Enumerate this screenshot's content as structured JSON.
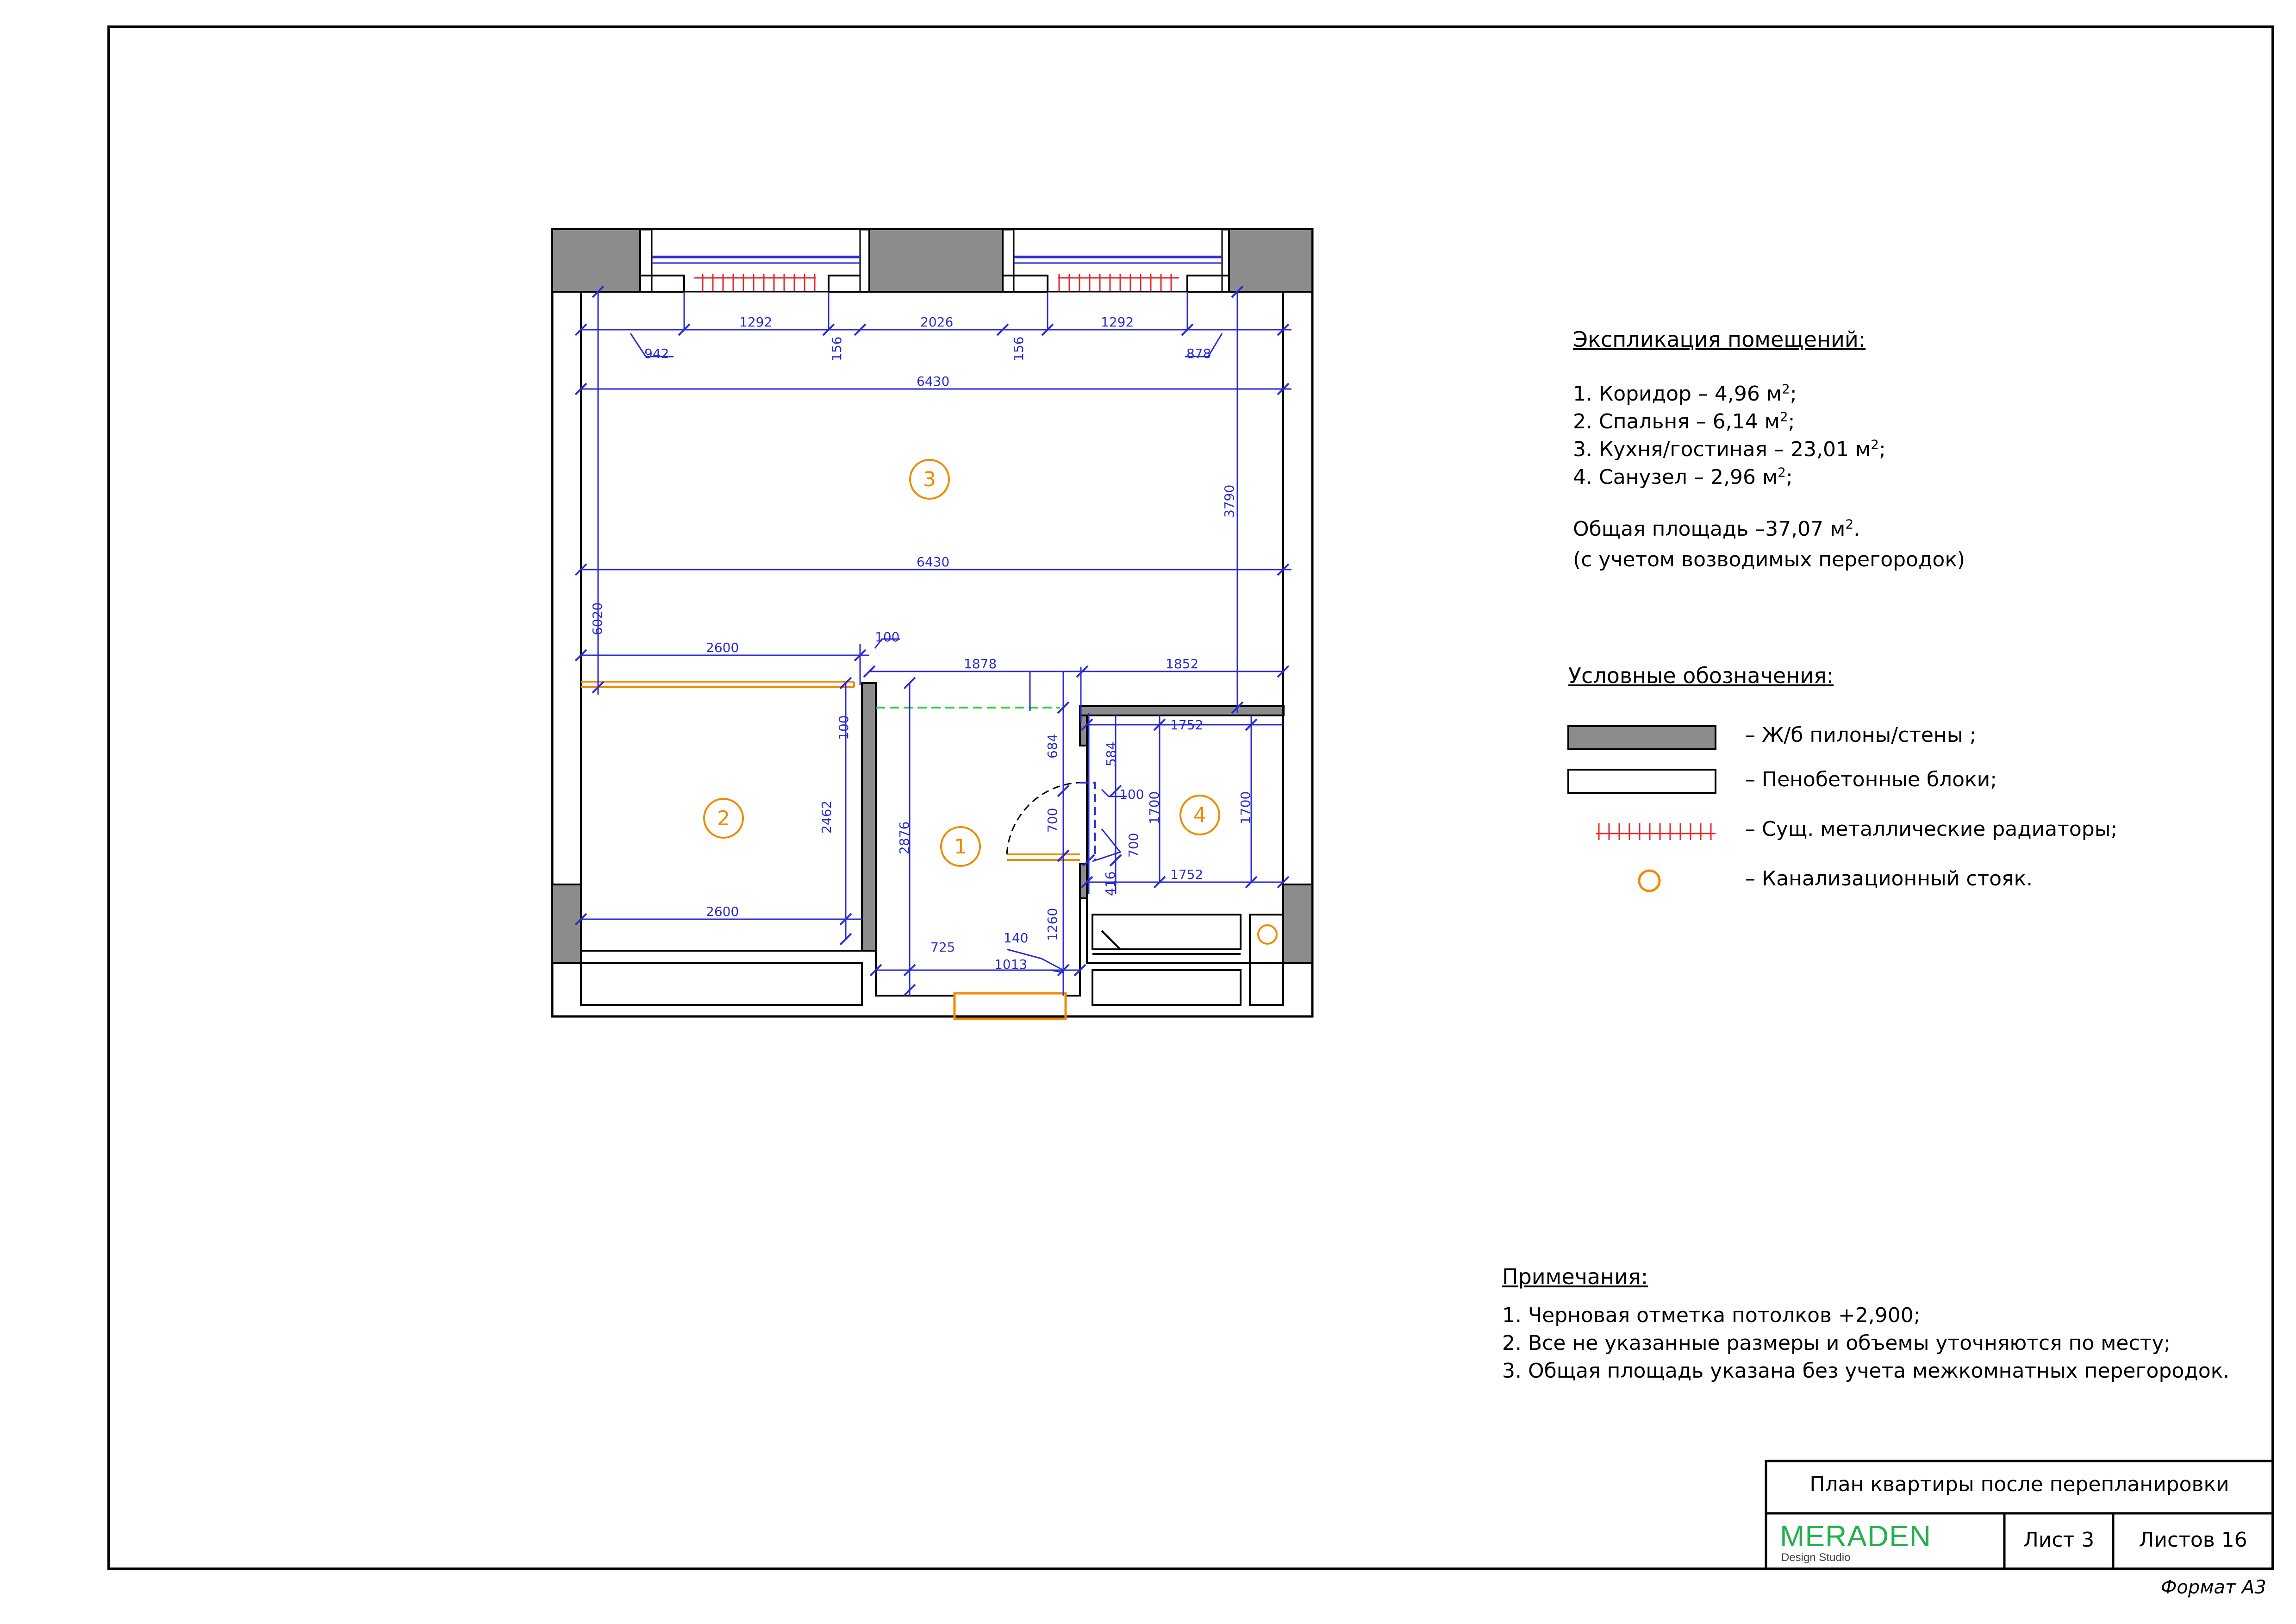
{
  "plan": {
    "dimensions": {
      "d942": "942",
      "d1292a": "1292",
      "d156a": "156",
      "d2026": "2026",
      "d156b": "156",
      "d1292b": "1292",
      "d878": "878",
      "d6430a": "6430",
      "d3790": "3790",
      "d6430b": "6430",
      "d6020": "6020",
      "d2600a": "2600",
      "d100a": "100",
      "d1878": "1878",
      "d1852": "1852",
      "d100b": "100",
      "d1752a": "1752",
      "d684": "684",
      "d584": "584",
      "d100c": "100",
      "d700a": "700",
      "d1700a": "1700",
      "d700b": "700",
      "d1700b": "1700",
      "d2462": "2462",
      "d2876": "2876",
      "d416": "416",
      "d1752b": "1752",
      "d2600b": "2600",
      "d1260": "1260",
      "d140": "140",
      "d725": "725",
      "d1013": "1013"
    },
    "rooms": {
      "r1": "1",
      "r2": "2",
      "r3": "3",
      "r4": "4"
    }
  },
  "explication": {
    "title": "Экспликация помещений:",
    "items": [
      {
        "text": "1. Коридор – 4,96 м",
        "sup": "2",
        "tail": ";"
      },
      {
        "text": "2. Спальня – 6,14 м",
        "sup": "2",
        "tail": ";"
      },
      {
        "text": "3. Кухня/гостиная – 23,01 м",
        "sup": "2",
        "tail": ";"
      },
      {
        "text": "4. Санузел – 2,96 м",
        "sup": "2",
        "tail": ";"
      }
    ],
    "total": {
      "text": "Общая площадь –37,07 м",
      "sup": "2",
      "tail": "."
    },
    "total_note": "(с учетом возводимых перегородок)"
  },
  "legend": {
    "title": "Условные обозначения:",
    "items": [
      {
        "icon": "concrete-wall-swatch",
        "label": "– Ж/б пилоны/стены ;",
        "color": "#8c8c8c"
      },
      {
        "icon": "foam-block-swatch",
        "label": "– Пенобетонные блоки;",
        "color": "#ffffff"
      },
      {
        "icon": "radiator-swatch",
        "label": "– Сущ. металлические радиаторы;",
        "color": "#e8242a"
      },
      {
        "icon": "sewer-riser-icon",
        "label": "– Канализационный стояк.",
        "color": "#f08a00"
      }
    ]
  },
  "notes": {
    "title": "Примечания:",
    "items": [
      "1. Черновая отметка потолков +2,900;",
      "2. Все не указанные размеры и объемы уточняются по месту;",
      "3. Общая площадь указана без учета межкомнатных перегородок."
    ]
  },
  "title_block": {
    "title": "План квартиры после перепланировки",
    "brand": "MERADEN",
    "brand_sub": "Design Studio",
    "sheet": "Лист 3",
    "sheets_total": "Листов 16",
    "format": "Формат  А3"
  },
  "colors": {
    "wall": "#8c8c8c",
    "dimension": "#2a2ad6",
    "room_marker": "#f08a00",
    "radiator": "#e8242a",
    "partition": "#f08a00",
    "opening": "#2bd12b"
  }
}
